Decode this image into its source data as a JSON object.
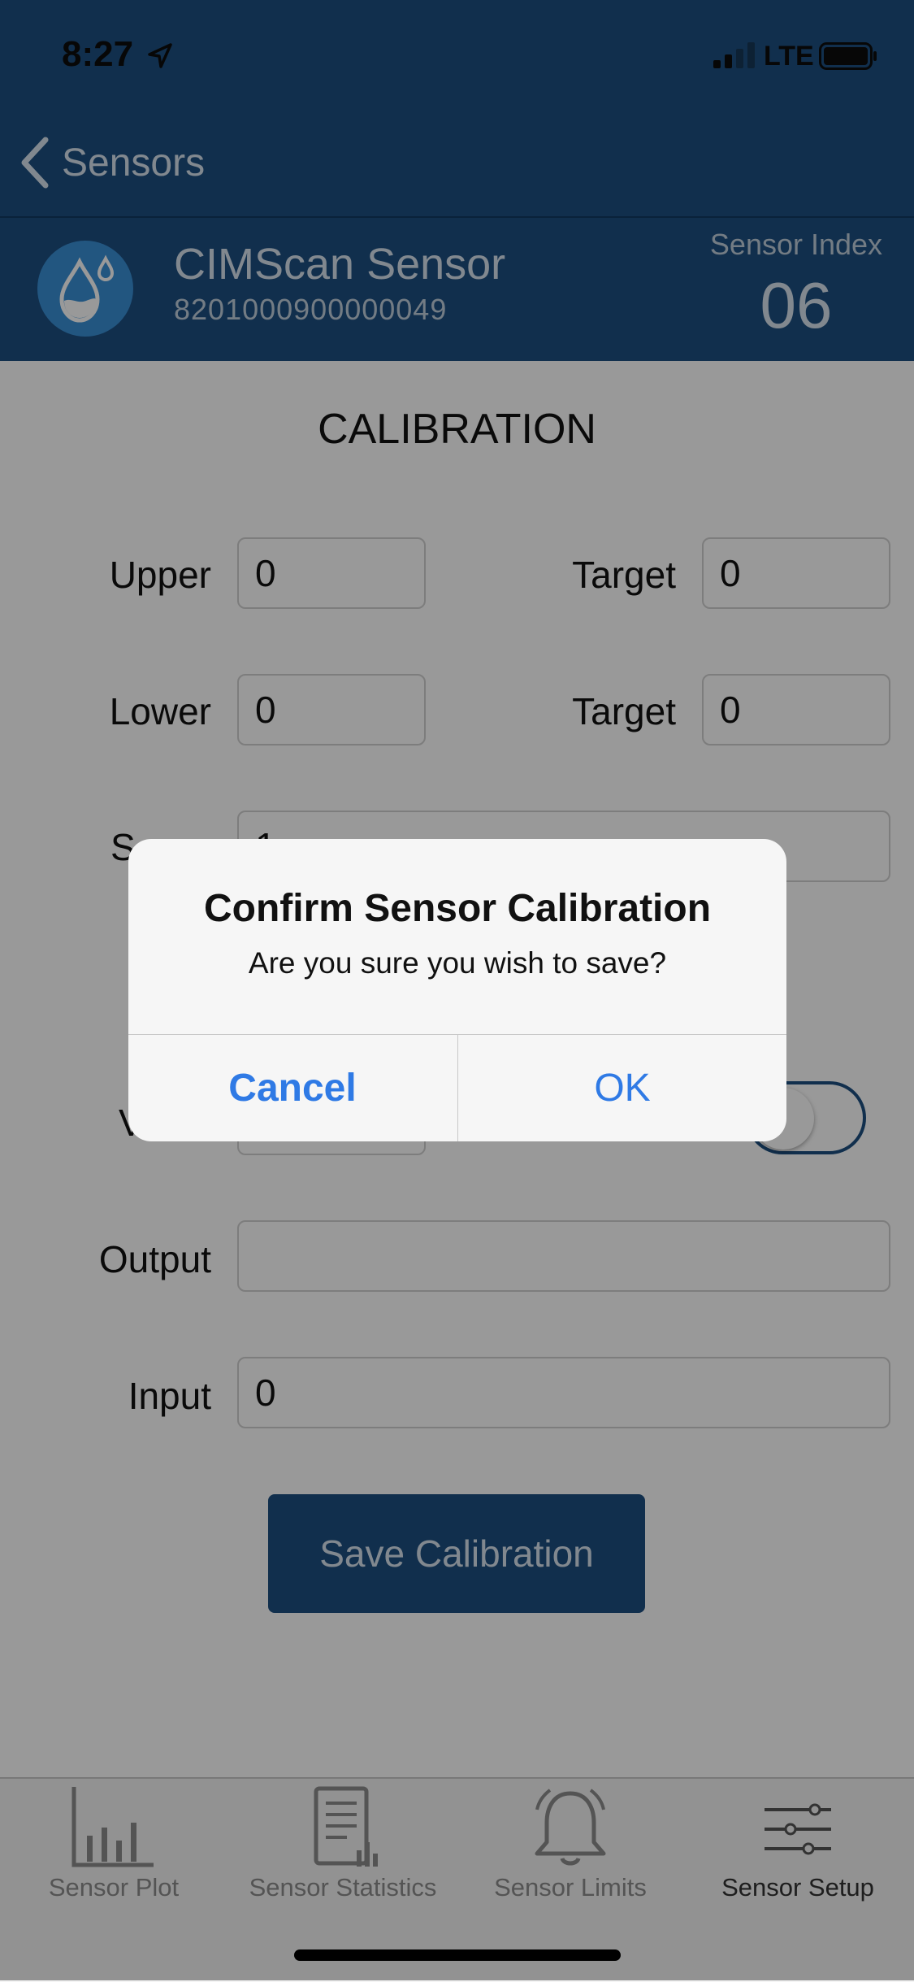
{
  "status_bar": {
    "time": "8:27",
    "network": "LTE"
  },
  "nav": {
    "back_label": "Sensors"
  },
  "sensor": {
    "name": "CIMScan Sensor",
    "serial": "8201000900000049",
    "index_label": "Sensor Index",
    "index_value": "06"
  },
  "calibration": {
    "title": "CALIBRATION",
    "upper_label": "Upper",
    "upper_value": "0",
    "upper_target_label": "Target",
    "upper_target_value": "0",
    "lower_label": "Lower",
    "lower_value": "0",
    "lower_target_label": "Target",
    "lower_target_value": "0",
    "scale_label_partial": "S",
    "scale_value_partial": "1",
    "v_label_partial": "V",
    "output_label": "Output",
    "output_value": "",
    "input_label": "Input",
    "input_value": "0",
    "save_button": "Save Calibration"
  },
  "tabs": [
    {
      "label": "Sensor Plot",
      "icon": "bar-chart-icon"
    },
    {
      "label": "Sensor Statistics",
      "icon": "document-chart-icon"
    },
    {
      "label": "Sensor Limits",
      "icon": "bell-icon"
    },
    {
      "label": "Sensor Setup",
      "icon": "sliders-icon",
      "active": true
    }
  ],
  "alert": {
    "title": "Confirm Sensor Calibration",
    "message": "Are you sure you wish to save?",
    "cancel": "Cancel",
    "ok": "OK"
  },
  "colors": {
    "brand": "#1d4f80",
    "alert_button": "#2f7ae5",
    "sensor_icon": "#3a8fd6"
  }
}
